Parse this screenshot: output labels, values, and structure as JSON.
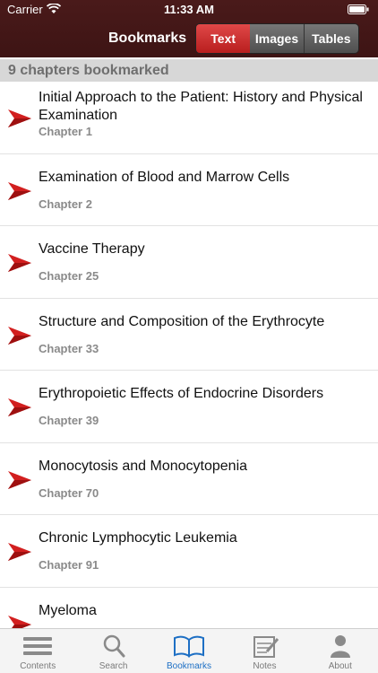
{
  "status": {
    "carrier": "Carrier",
    "time": "11:33 AM"
  },
  "nav": {
    "title": "Bookmarks",
    "segments": [
      "Text",
      "Images",
      "Tables"
    ],
    "selected_segment": "Text"
  },
  "section_header": "9 chapters bookmarked",
  "bookmarks": [
    {
      "title": "Initial Approach to the Patient: History and Physical Examination",
      "chapter": "Chapter 1"
    },
    {
      "title": "Examination of Blood and Marrow Cells",
      "chapter": "Chapter 2"
    },
    {
      "title": "Vaccine Therapy",
      "chapter": "Chapter 25"
    },
    {
      "title": "Structure and Composition of the Erythrocyte",
      "chapter": "Chapter 33"
    },
    {
      "title": "Erythropoietic Effects of Endocrine Disorders",
      "chapter": "Chapter 39"
    },
    {
      "title": "Monocytosis and Monocytopenia",
      "chapter": "Chapter 70"
    },
    {
      "title": "Chronic Lymphocytic Leukemia",
      "chapter": "Chapter 91"
    },
    {
      "title": "Myeloma",
      "chapter": ""
    }
  ],
  "tabbar": {
    "tabs": [
      {
        "label": "Contents",
        "icon": "list-icon"
      },
      {
        "label": "Search",
        "icon": "search-icon"
      },
      {
        "label": "Bookmarks",
        "icon": "open-book-icon"
      },
      {
        "label": "Notes",
        "icon": "notepad-icon"
      },
      {
        "label": "About",
        "icon": "person-icon"
      }
    ],
    "active": "Bookmarks"
  },
  "colors": {
    "header": "#3d1414",
    "accent_red": "#d42a2a",
    "active_tab": "#1d6fc4"
  }
}
